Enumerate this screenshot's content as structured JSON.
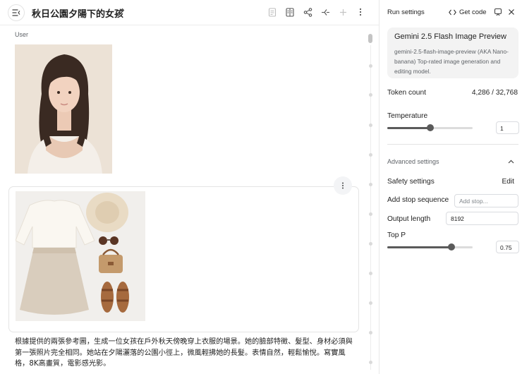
{
  "header": {
    "title": "秋日公園夕陽下的女孩",
    "icons": [
      "menu-icon",
      "edit-icon",
      "notes-icon",
      "compare-icon",
      "share-icon",
      "branch-icon",
      "add-icon",
      "more-vert-icon"
    ]
  },
  "chat": {
    "user_label": "User",
    "prompt_text": "根據提供的兩張參考圖，生成一位女孩在戶外秋天傍晚穿上衣服的場景。她的臉部特徵、髮型、身材必須與第一張照片完全相同。她站在夕陽灑落的公園小徑上，微風輕拂她的長髮。表情自然，輕鬆愉悅。寫實風格，8K高畫質，電影感光影。"
  },
  "settings": {
    "title": "Run settings",
    "get_code": "Get code",
    "model": {
      "name": "Gemini 2.5 Flash Image Preview",
      "description": "gemini-2.5-flash-image-preview (AKA Nano-banana) Top-rated image generation and editing model."
    },
    "token_count_label": "Token count",
    "token_count_value": "4,286 / 32,768",
    "temperature_label": "Temperature",
    "temperature_value": "1",
    "temperature_level": 0.5,
    "advanced_label": "Advanced settings",
    "safety_label": "Safety settings",
    "safety_edit": "Edit",
    "stop_label": "Add stop sequence",
    "stop_placeholder": "Add stop...",
    "output_length_label": "Output length",
    "output_length_value": "8192",
    "top_p_label": "Top P",
    "top_p_value": "0.75",
    "top_p_level": 0.75
  },
  "colors": {
    "accent": "#5a5a5a",
    "card_bg": "#f3f3f3",
    "border": "#e4e4e4"
  }
}
